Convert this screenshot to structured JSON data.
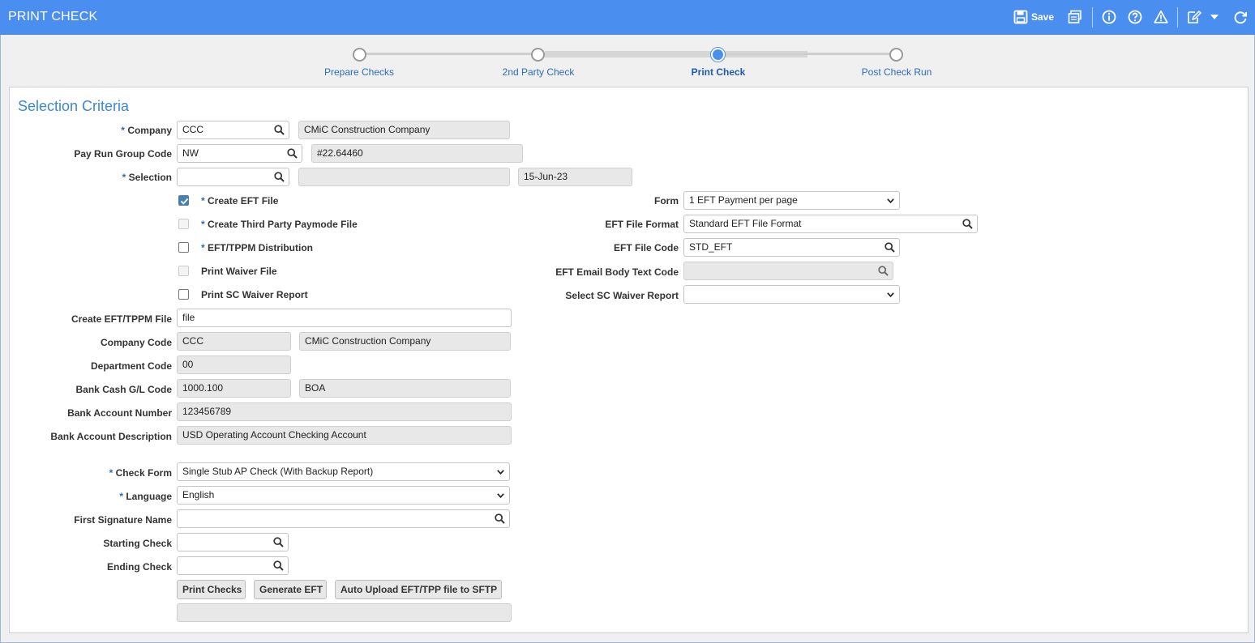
{
  "header": {
    "title": "PRINT CHECK",
    "save_label": "Save",
    "icons": [
      "save-icon",
      "print-icon",
      "info-icon",
      "help-icon",
      "warning-icon",
      "edit-icon",
      "chevron-down-icon",
      "refresh-icon"
    ]
  },
  "stepper": {
    "steps": [
      {
        "label": "Prepare Checks",
        "active": false
      },
      {
        "label": "2nd Party Check",
        "active": false
      },
      {
        "label": "Print Check",
        "active": true
      },
      {
        "label": "Post Check Run",
        "active": false
      }
    ],
    "accent_color": "#4a8ef0"
  },
  "section": {
    "title": "Selection Criteria"
  },
  "fields": {
    "company": {
      "label": "Company",
      "required": "* ",
      "value": "CCC",
      "description": "CMiC Construction Company"
    },
    "pay_run_group_code": {
      "label": "Pay Run Group Code",
      "value": "NW",
      "description": "#22.64460"
    },
    "selection": {
      "label": "Selection",
      "required": "* ",
      "value": "",
      "description": "",
      "date": "15-Jun-23"
    },
    "create_eft_tppm_file": {
      "label": "Create EFT/TPPM File",
      "value": "file"
    },
    "company_code": {
      "label": "Company Code",
      "value": "CCC",
      "description": "CMiC Construction Company"
    },
    "department_code": {
      "label": "Department Code",
      "value": "00"
    },
    "bank_cash_gl_code": {
      "label": "Bank Cash G/L Code",
      "value": "1000.100",
      "description": "BOA"
    },
    "bank_account_number": {
      "label": "Bank Account Number",
      "value": "123456789"
    },
    "bank_account_description": {
      "label": "Bank Account Description",
      "value": "USD Operating Account Checking Account"
    },
    "check_form": {
      "label": "Check Form",
      "required": "* ",
      "value": "Single Stub AP Check (With Backup Report)"
    },
    "language": {
      "label": "Language",
      "required": "* ",
      "value": "English"
    },
    "first_signature_name": {
      "label": "First Signature Name",
      "value": ""
    },
    "starting_check": {
      "label": "Starting Check",
      "value": ""
    },
    "ending_check": {
      "label": "Ending Check",
      "value": ""
    },
    "status_output": {
      "value": ""
    }
  },
  "checkboxes": {
    "create_eft_file": {
      "label": "Create EFT File",
      "required": "* ",
      "checked": true
    },
    "create_third_party_paymode_file": {
      "label": "Create Third Party Paymode File",
      "required": "* ",
      "checked": false,
      "disabled": true
    },
    "eft_tppm_distribution": {
      "label": "EFT/TPPM Distribution",
      "required": "* ",
      "checked": false
    },
    "print_waiver_file": {
      "label": "Print Waiver File",
      "checked": false,
      "disabled": true
    },
    "print_sc_waiver_report": {
      "label": "Print SC Waiver Report",
      "checked": false
    }
  },
  "right_fields": {
    "form": {
      "label": "Form",
      "value": "1 EFT Payment per page"
    },
    "eft_file_format": {
      "label": "EFT File Format",
      "value": "Standard EFT File Format"
    },
    "eft_file_code": {
      "label": "EFT File Code",
      "value": "STD_EFT"
    },
    "eft_email_body_text_code": {
      "label": "EFT Email Body Text Code",
      "value": ""
    },
    "select_sc_waiver_report": {
      "label": "Select SC Waiver Report",
      "value": ""
    }
  },
  "buttons": {
    "print_checks": "Print Checks",
    "generate_eft": "Generate EFT",
    "auto_upload": "Auto Upload EFT/TPP file to SFTP"
  }
}
